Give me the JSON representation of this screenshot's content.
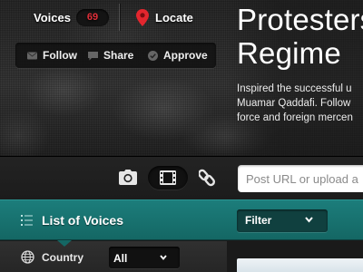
{
  "header": {
    "voices_label": "Voices",
    "voices_count": "69",
    "locate_label": "Locate"
  },
  "actions": {
    "follow": "Follow",
    "share": "Share",
    "approve": "Approve"
  },
  "story": {
    "headline_line1": "Protesters",
    "headline_line2": "Regime",
    "summary_line1": "Inspired the successful u",
    "summary_line2": "Muamar Qaddafi. Follow",
    "summary_line3": "force and foreign mercen"
  },
  "post": {
    "url_placeholder": "Post URL or upload a",
    "icons": [
      "camera-icon",
      "video-icon",
      "link-icon"
    ]
  },
  "list": {
    "title": "List of Voices",
    "filter_label": "Filter"
  },
  "country": {
    "label": "Country",
    "selected": "All"
  },
  "colors": {
    "accent_teal": "#1c7d7b",
    "badge_red": "#e3303b",
    "pin_red": "#e3262e"
  }
}
